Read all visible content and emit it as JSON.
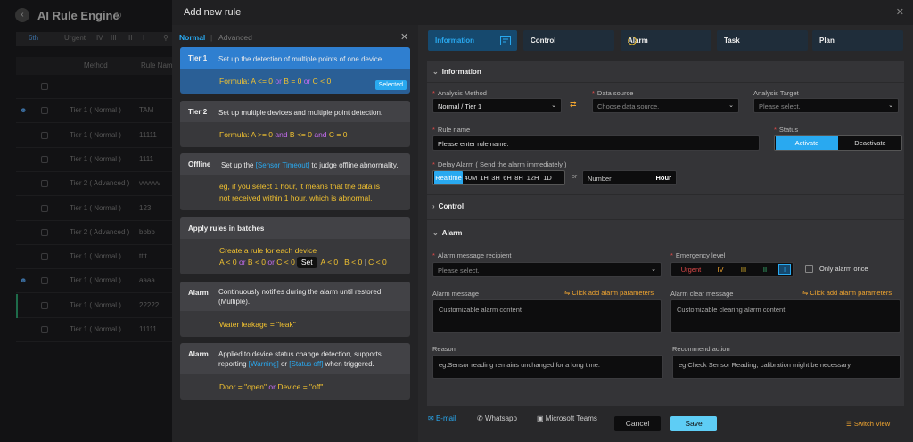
{
  "app": {
    "title": "AI Rule Engine"
  },
  "bg_page": {
    "toolbar": {
      "count": "6th",
      "urgent": "Urgent",
      "iv": "IV",
      "iii": "III",
      "ii": "II",
      "i": "I"
    },
    "columns": {
      "method": "Method",
      "rule_name": "Rule Name"
    },
    "rows": [
      {
        "method": "",
        "name": ""
      },
      {
        "method": "Tier 1 ( Normal )",
        "name": "TAM"
      },
      {
        "method": "Tier 1 ( Normal )",
        "name": "11111"
      },
      {
        "method": "Tier 1 ( Normal )",
        "name": "1111"
      },
      {
        "method": "Tier 2 ( Advanced )",
        "name": "vvvvvv"
      },
      {
        "method": "Tier 1 ( Normal )",
        "name": "123"
      },
      {
        "method": "Tier 2 ( Advanced )",
        "name": "bbbb"
      },
      {
        "method": "Tier 1 ( Normal )",
        "name": "tttt"
      },
      {
        "method": "Tier 1 ( Normal )",
        "name": "aaaa"
      },
      {
        "method": "Tier 1 ( Normal )",
        "name": "22222"
      },
      {
        "method": "Tier 1 ( Normal )",
        "name": "11111"
      }
    ]
  },
  "drawer": {
    "title": "Add new rule"
  },
  "left": {
    "tabs": {
      "normal": "Normal",
      "sep": "|",
      "advanced": "Advanced"
    },
    "tier1": {
      "label": "Tier 1",
      "desc": "Set up the detection of multiple points of one device.",
      "f1": "Formula: A <= 0 ",
      "f_or1": "or",
      "f2": " B = 0 ",
      "f_or2": "or",
      "f3": " C < 0",
      "badge": "Selected"
    },
    "tier2": {
      "label": "Tier 2",
      "desc": "Set up multiple devices and multiple point detection.",
      "f1": "Formula: A >= 0 ",
      "f_and1": "and",
      "f2": " B <= 0 ",
      "f_and2": "and",
      "f3": " C = 0"
    },
    "offline": {
      "label": "Offline",
      "desc_a": "Set up the ",
      "desc_link": "[Sensor Timeout]",
      "desc_b": " to judge offline abnormality.",
      "ex1": "eg, if you select 1 hour, it means that the data is",
      "ex2": "not received within 1 hour, which is abnormal."
    },
    "batch": {
      "label": "Apply rules in batches",
      "line1": "Create a rule for each device",
      "a1": "A < 0 ",
      "or1": "or",
      "a2": " B < 0 ",
      "or2": "or",
      "a3": " C < 0",
      "set": "Set",
      "s1": "A < 0",
      "sep1": "|",
      "s2": "B < 0",
      "sep2": "|",
      "s3": "C < 0"
    },
    "alarm": {
      "label": "Alarm",
      "desc1": "Continuously notifies during the alarm until restored",
      "desc2": "(Multiple).",
      "ex": "Water leakage =  \"leak\""
    },
    "alarm2": {
      "label": "Alarm",
      "desc1": "Applied to device status change detection, supports",
      "d2a": "reporting ",
      "d2w": "[Warning]",
      "d2or": " or ",
      "d2s": "[Status off]",
      "d2b": " when triggered.",
      "e1": "Door = \"open\" ",
      "eor": "or",
      "e2": " Device = \"off\""
    }
  },
  "right": {
    "tabs": [
      {
        "label": "Information"
      },
      {
        "label": "Control"
      },
      {
        "label": "Alarm"
      },
      {
        "label": "Task"
      },
      {
        "label": "Plan"
      }
    ],
    "info": {
      "section": "Information",
      "analysis_method_label": "Analysis Method",
      "analysis_method_value": "Normal / Tier 1",
      "data_source_label": "Data source",
      "data_source_ph": "Choose data source.",
      "analysis_target_label": "Analysis Target",
      "analysis_target_ph": "Please select.",
      "rule_name_label": "Rule name",
      "rule_name_ph": "Please enter rule name.",
      "status_label": "Status",
      "status_activate": "Activate",
      "status_deactivate": "Deactivate",
      "delay_label": "Delay Alarm ( Send the alarm immediately )",
      "delay_opts": [
        "Realtime",
        "40M",
        "1H",
        "3H",
        "6H",
        "8H",
        "12H",
        "1D"
      ],
      "delay_or": "or",
      "delay_num_ph": "Number",
      "delay_unit": "Hour"
    },
    "control": {
      "section": "Control"
    },
    "alarm": {
      "section": "Alarm",
      "recipient_label": "Alarm message recipient",
      "recipient_ph": "Please select.",
      "emergency_label": "Emergency level",
      "levels": [
        "Urgent",
        "IV",
        "III",
        "II",
        "I"
      ],
      "only_once": "Only alarm once",
      "msg_label": "Alarm message",
      "msg_link": "Click add alarm parameters",
      "msg_ph": "Customizable alarm content",
      "clear_label": "Alarm clear message",
      "clear_link": "Click add alarm parameters",
      "clear_ph": "Customizable clearing alarm content",
      "reason_label": "Reason",
      "reason_ph": "eg.Sensor reading remains unchanged for a long time.",
      "action_label": "Recommend action",
      "action_ph": "eg.Check Sensor Reading, calibration might be necessary."
    },
    "channels": {
      "email": "E-mail",
      "whatsapp": "Whatsapp",
      "teams": "Microsoft Teams",
      "switch": "Switch View"
    },
    "buttons": {
      "cancel": "Cancel",
      "save": "Save"
    }
  },
  "colors": {
    "accent": "#29a9f0",
    "formula": "#f2c230",
    "link": "#f2a630",
    "required": "#e24a4a"
  }
}
